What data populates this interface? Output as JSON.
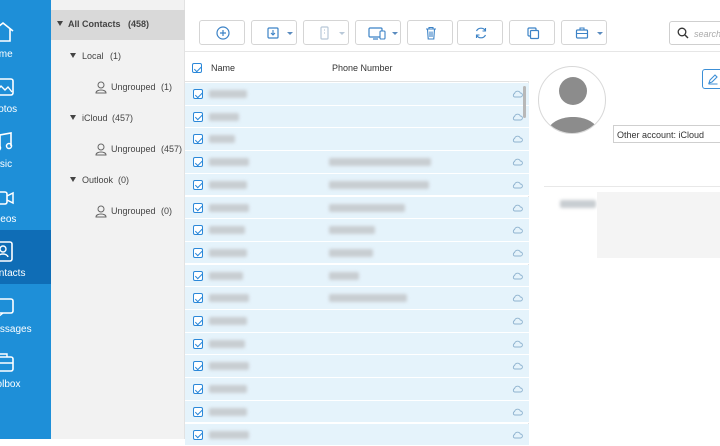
{
  "nav": {
    "items": [
      {
        "label": "Home",
        "icon": "home-icon"
      },
      {
        "label": "Photos",
        "icon": "photos-icon"
      },
      {
        "label": "Music",
        "icon": "music-icon"
      },
      {
        "label": "Videos",
        "icon": "videos-icon"
      },
      {
        "label": "Contacts",
        "icon": "contacts-icon",
        "active": true
      },
      {
        "label": "Messages",
        "icon": "messages-icon"
      },
      {
        "label": "Toolbox",
        "icon": "toolbox-icon"
      }
    ]
  },
  "tree": {
    "all_contacts": "All Contacts",
    "all_count": "(458)",
    "groups": [
      {
        "name": "Local",
        "count": "(1)",
        "sub_label": "Ungrouped",
        "sub_count": "(1)"
      },
      {
        "name": "iCloud",
        "count": "(457)",
        "sub_label": "Ungrouped",
        "sub_count": "(457)"
      },
      {
        "name": "Outlook",
        "count": "(0)",
        "sub_label": "Ungrouped",
        "sub_count": "(0)"
      }
    ]
  },
  "toolbar": {
    "buttons": [
      "add-icon",
      "import-icon",
      "export-icon",
      "transfer-to-device-icon",
      "delete-icon",
      "refresh-icon",
      "duplicate-icon",
      "toolbox-icon"
    ],
    "search_placeholder": "search"
  },
  "table": {
    "col_name": "Name",
    "col_phone": "Phone Number",
    "row_count_visible": 16
  },
  "detail": {
    "account_label": "Other account: iCloud"
  },
  "colors": {
    "nav_bg": "#1e8fd8",
    "nav_active": "#0f6db6",
    "row_bg": "#e5f3fb",
    "accent": "#2b88d9"
  }
}
